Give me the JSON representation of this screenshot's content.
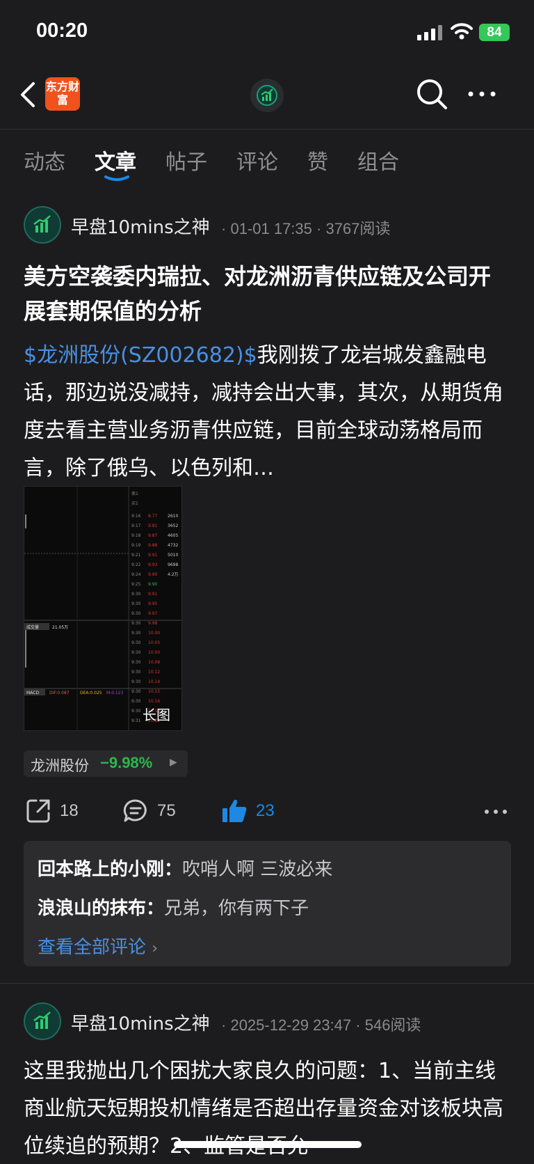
{
  "status": {
    "time": "00:20",
    "battery": "84"
  },
  "nav": {
    "logo_text": "东方财富"
  },
  "tabs": [
    {
      "label": "动态"
    },
    {
      "label": "文章"
    },
    {
      "label": "帖子"
    },
    {
      "label": "评论"
    },
    {
      "label": "赞"
    },
    {
      "label": "组合"
    }
  ],
  "post1": {
    "author": "早盘10mins之神",
    "date": "01-01 17:35",
    "reads": "3767阅读",
    "title": "美方空袭委内瑞拉、对龙洲沥青供应链及公司开展套期保值的分析",
    "stock_link": "$龙洲股份(SZ002682)$",
    "body": "我刚拨了龙岩城发鑫融电话，那边说没减持，减持会出大事，其次，从期货角度去看主营业务沥青供应链，目前全球动荡格局而言，除了俄乌、以色列和…",
    "image_label": "长图",
    "stock_tag": {
      "name": "龙洲股份",
      "change": "−9.98%"
    },
    "actions": {
      "share": "18",
      "comment": "75",
      "like": "23"
    },
    "comments": [
      {
        "user": "回本路上的小刚：",
        "text": "吹哨人啊 三波必来"
      },
      {
        "user": "浪浪山的抹布：",
        "text": "兄弟，你有两下子"
      }
    ],
    "view_all": "查看全部评论"
  },
  "post2": {
    "author": "早盘10mins之神",
    "date": "2025-12-29 23:47",
    "reads": "546阅读",
    "body": "这里我抛出几个困扰大家良久的问题：1、当前主线商业航天短期投机情绪是否超出存量资金对该板块高位续追的预期？2、监管是否允"
  },
  "colors": {
    "accent": "#4a90e2",
    "down_green": "#2db84d",
    "brand_orange": "#f0521c",
    "like_blue": "#1e88e5"
  }
}
